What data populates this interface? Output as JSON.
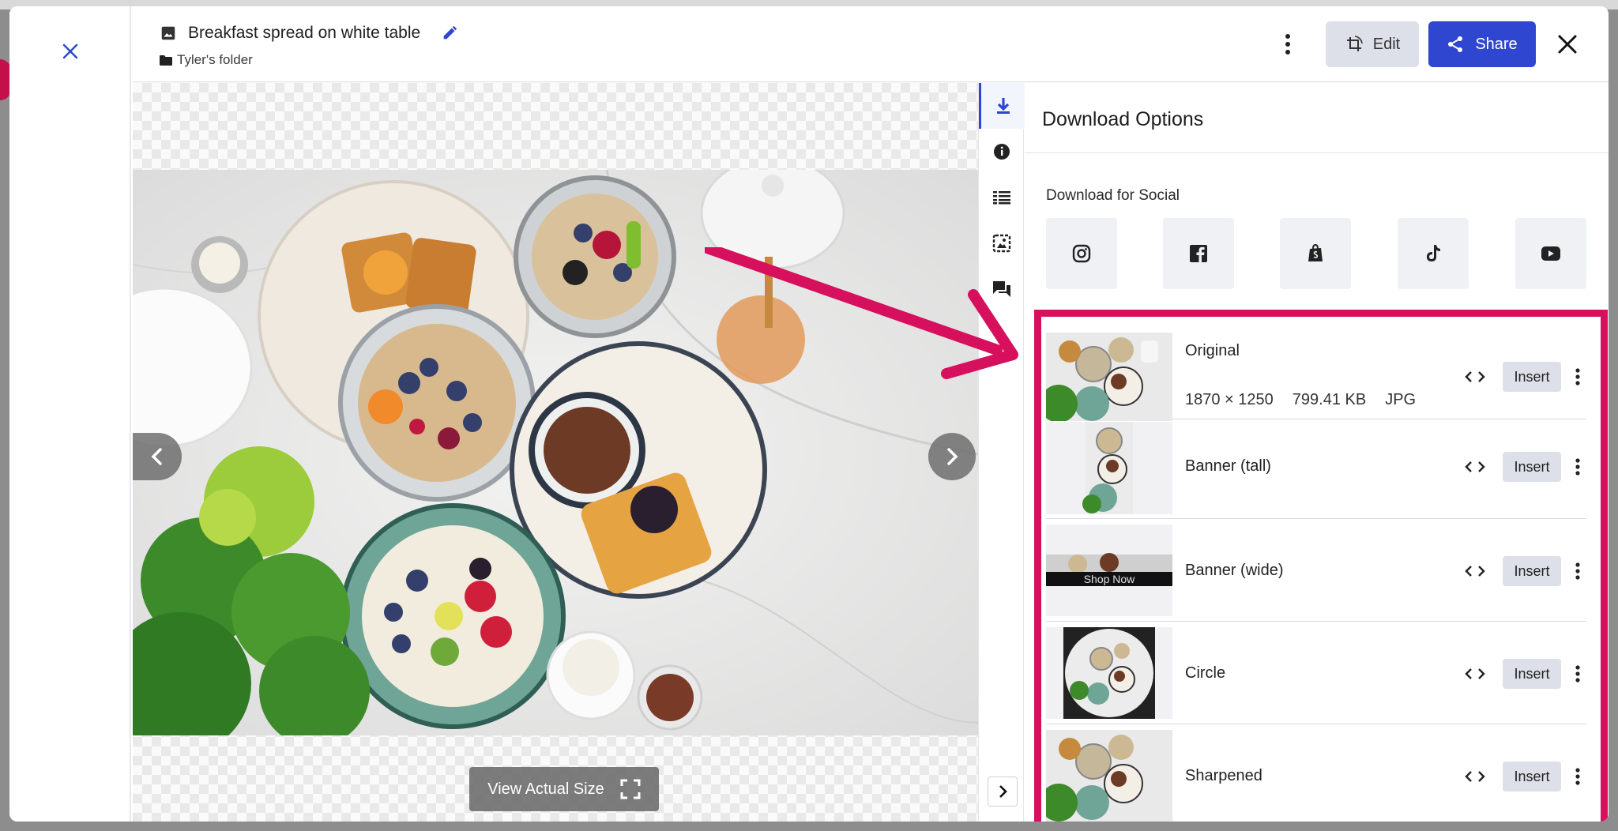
{
  "header": {
    "title": "Breakfast spread on white table",
    "folder": "Tyler's folder",
    "edit_label": "Edit",
    "share_label": "Share"
  },
  "viewer": {
    "view_actual_label": "View Actual Size"
  },
  "panel": {
    "title": "Download Options",
    "social_title": "Download for Social",
    "social": [
      {
        "icon": "instagram-icon"
      },
      {
        "icon": "facebook-icon"
      },
      {
        "icon": "shopify-icon"
      },
      {
        "icon": "tiktok-icon"
      },
      {
        "icon": "youtube-icon"
      }
    ],
    "crops": [
      {
        "name": "Original",
        "dimensions": "1870 × 1250",
        "size": "799.41 KB",
        "format": "JPG",
        "insert_label": "Insert"
      },
      {
        "name": "Banner (tall)",
        "insert_label": "Insert"
      },
      {
        "name": "Banner (wide)",
        "insert_label": "Insert",
        "thumb_text": "Shop Now"
      },
      {
        "name": "Circle",
        "insert_label": "Insert"
      },
      {
        "name": "Sharpened",
        "insert_label": "Insert"
      }
    ]
  },
  "colors": {
    "accent": "#2f46d0",
    "highlight": "#d6105c"
  }
}
